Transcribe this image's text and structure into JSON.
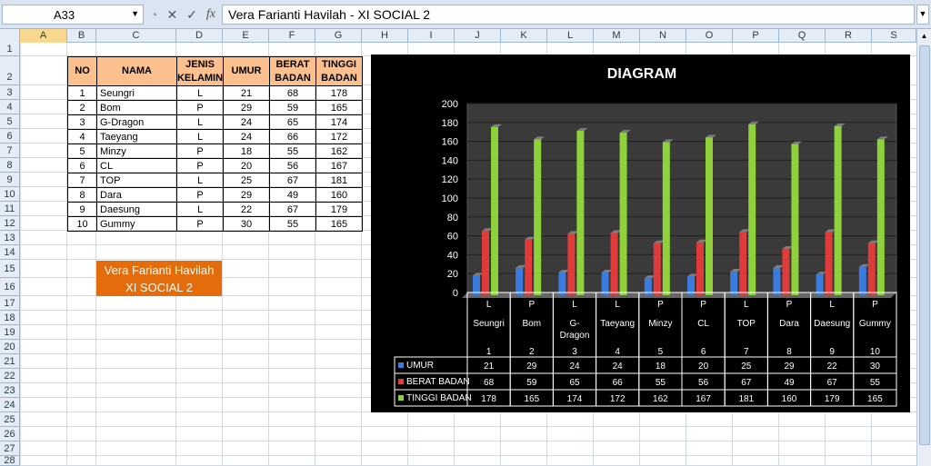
{
  "formula_bar": {
    "name_box": "A33",
    "formula": "Vera Farianti Havilah - XI SOCIAL 2"
  },
  "columns": [
    "A",
    "B",
    "C",
    "D",
    "E",
    "F",
    "G",
    "H",
    "I",
    "J",
    "K",
    "L",
    "M",
    "N",
    "O",
    "P",
    "Q",
    "R",
    "S"
  ],
  "rows": [
    "1",
    "2",
    "3",
    "4",
    "5",
    "6",
    "7",
    "8",
    "9",
    "10",
    "11",
    "12",
    "13",
    "14",
    "15",
    "16",
    "17",
    "18",
    "19",
    "20",
    "21",
    "22",
    "23",
    "24",
    "25",
    "26",
    "27",
    "28"
  ],
  "table": {
    "headers": [
      "NO",
      "NAMA",
      "JENIS KELAMIN",
      "UMUR",
      "BERAT BADAN",
      "TINGGI BADAN"
    ],
    "header_lines": [
      [
        "NO"
      ],
      [
        "NAMA"
      ],
      [
        "JENIS",
        "KELAMIN"
      ],
      [
        "UMUR"
      ],
      [
        "BERAT",
        "BADAN"
      ],
      [
        "TINGGI",
        "BADAN"
      ]
    ],
    "rows": [
      [
        "1",
        "Seungri",
        "L",
        "21",
        "68",
        "178"
      ],
      [
        "2",
        "Bom",
        "P",
        "29",
        "59",
        "165"
      ],
      [
        "3",
        "G-Dragon",
        "L",
        "24",
        "65",
        "174"
      ],
      [
        "4",
        "Taeyang",
        "L",
        "24",
        "66",
        "172"
      ],
      [
        "5",
        "Minzy",
        "P",
        "18",
        "55",
        "162"
      ],
      [
        "6",
        "CL",
        "P",
        "20",
        "56",
        "167"
      ],
      [
        "7",
        "TOP",
        "L",
        "25",
        "67",
        "181"
      ],
      [
        "8",
        "Dara",
        "P",
        "29",
        "49",
        "160"
      ],
      [
        "9",
        "Daesung",
        "L",
        "22",
        "67",
        "179"
      ],
      [
        "10",
        "Gummy",
        "P",
        "30",
        "55",
        "165"
      ]
    ]
  },
  "author_box": [
    "Vera Farianti Havilah",
    "XI SOCIAL 2"
  ],
  "chart_data": {
    "type": "bar",
    "title": "DIAGRAM",
    "ylim": [
      0,
      200
    ],
    "yticks": [
      0,
      20,
      40,
      60,
      80,
      100,
      120,
      140,
      160,
      180,
      200
    ],
    "categories": [
      [
        "L",
        "Seungri",
        "1"
      ],
      [
        "P",
        "Bom",
        "2"
      ],
      [
        "L",
        "G-Dragon",
        "3"
      ],
      [
        "L",
        "Taeyang",
        "4"
      ],
      [
        "P",
        "Minzy",
        "5"
      ],
      [
        "P",
        "CL",
        "6"
      ],
      [
        "L",
        "TOP",
        "7"
      ],
      [
        "P",
        "Dara",
        "8"
      ],
      [
        "L",
        "Daesung",
        "9"
      ],
      [
        "P",
        "Gummy",
        "10"
      ]
    ],
    "series": [
      {
        "name": "UMUR",
        "color": "#3b7be0",
        "values": [
          21,
          29,
          24,
          24,
          18,
          20,
          25,
          29,
          22,
          30
        ]
      },
      {
        "name": "BERAT BADAN",
        "color": "#e03b3b",
        "values": [
          68,
          59,
          65,
          66,
          55,
          56,
          67,
          49,
          67,
          55
        ]
      },
      {
        "name": "TINGGI BADAN",
        "color": "#8fd13a",
        "values": [
          178,
          165,
          174,
          172,
          162,
          167,
          181,
          160,
          179,
          165
        ]
      }
    ],
    "grid": true,
    "legend": "data-table"
  }
}
